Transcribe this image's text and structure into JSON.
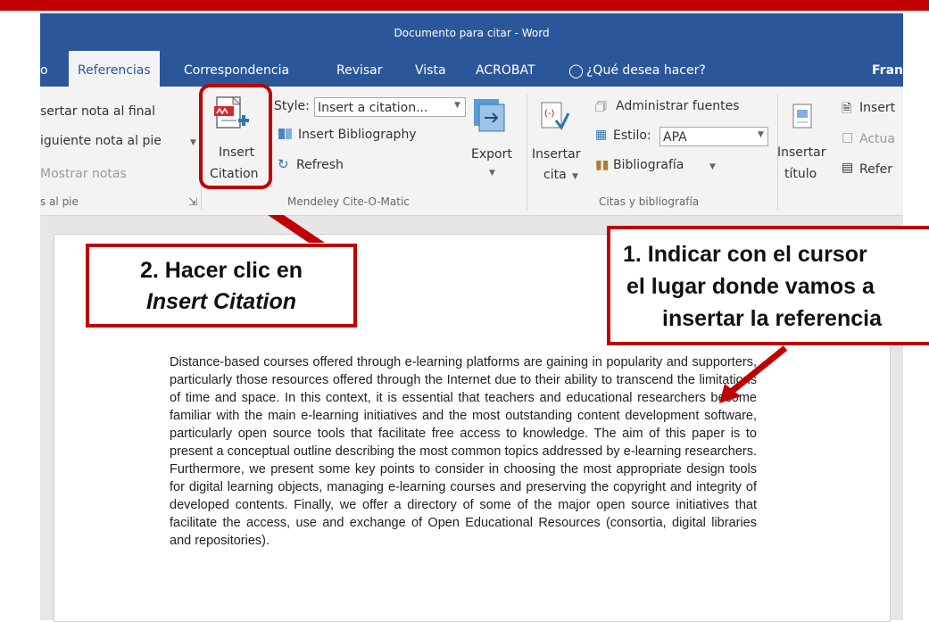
{
  "window": {
    "title": "Documento para citar - Word"
  },
  "tabs": [
    {
      "label": "o"
    },
    {
      "label": "Referencias"
    },
    {
      "label": "Correspondencia"
    },
    {
      "label": "Revisar"
    },
    {
      "label": "Vista"
    },
    {
      "label": "ACROBAT"
    },
    {
      "label": "¿Qué desea hacer?"
    },
    {
      "label": "Fran"
    }
  ],
  "ribbon": {
    "footnotes": {
      "insert_endnote": "sertar nota al final",
      "next_footnote": "iguiente nota al pie",
      "show_notes": "Mostrar notas",
      "group_label": "s al pie"
    },
    "mendeley": {
      "insert_citation_line1": "Insert",
      "insert_citation_line2": "Citation",
      "style_label": "Style:",
      "style_value": "Insert a citation...",
      "insert_bibliography": "Insert Bibliography",
      "refresh": "Refresh",
      "export": "Export",
      "group_label": "Mendeley Cite-O-Matic"
    },
    "citations": {
      "insertar_line1": "Insertar",
      "insertar_line2": "cita",
      "manage_sources": "Administrar fuentes",
      "style_label": "Estilo:",
      "style_value": "APA",
      "bibliography": "Bibliografía",
      "group_label": "Citas y bibliografía"
    },
    "captions": {
      "insert_caption_line1": "Insertar",
      "insert_caption_line2": "título",
      "insert_table": "Insert",
      "update": "Actua",
      "cross_ref": "Refer"
    }
  },
  "callouts": {
    "step2_line1": "2. Hacer clic en",
    "step2_line2": "Insert Citation",
    "step1_line1": "1. Indicar con el cursor",
    "step1_line2": "el lugar donde vamos a",
    "step1_line3": "insertar la referencia"
  },
  "document": {
    "paragraph": "Distance-based courses offered through e-learning platforms are gaining in popularity and supporters, particularly those resources offered through the Internet due to their ability to transcend the limitations of time and space. In this context, it is essential that teachers and educational researchers become familiar with the main e-learning initiatives and the most outstanding content development software, particularly open source tools that facilitate free access to knowledge. The aim of this paper is to present a conceptual outline describing the most common topics addressed by e-learning researchers. Furthermore, we present some key points to consider in choosing the most appropriate design tools for digital learning objects, managing e-learning courses and preserving the copyright and integrity of developed contents. Finally, we offer a directory of some of the major open source initiatives that facilitate the access, use and exchange of Open Educational Resources (consortia, digital libraries and repositories)."
  },
  "colors": {
    "word_blue": "#2b579a",
    "callout_red": "#c00000"
  }
}
